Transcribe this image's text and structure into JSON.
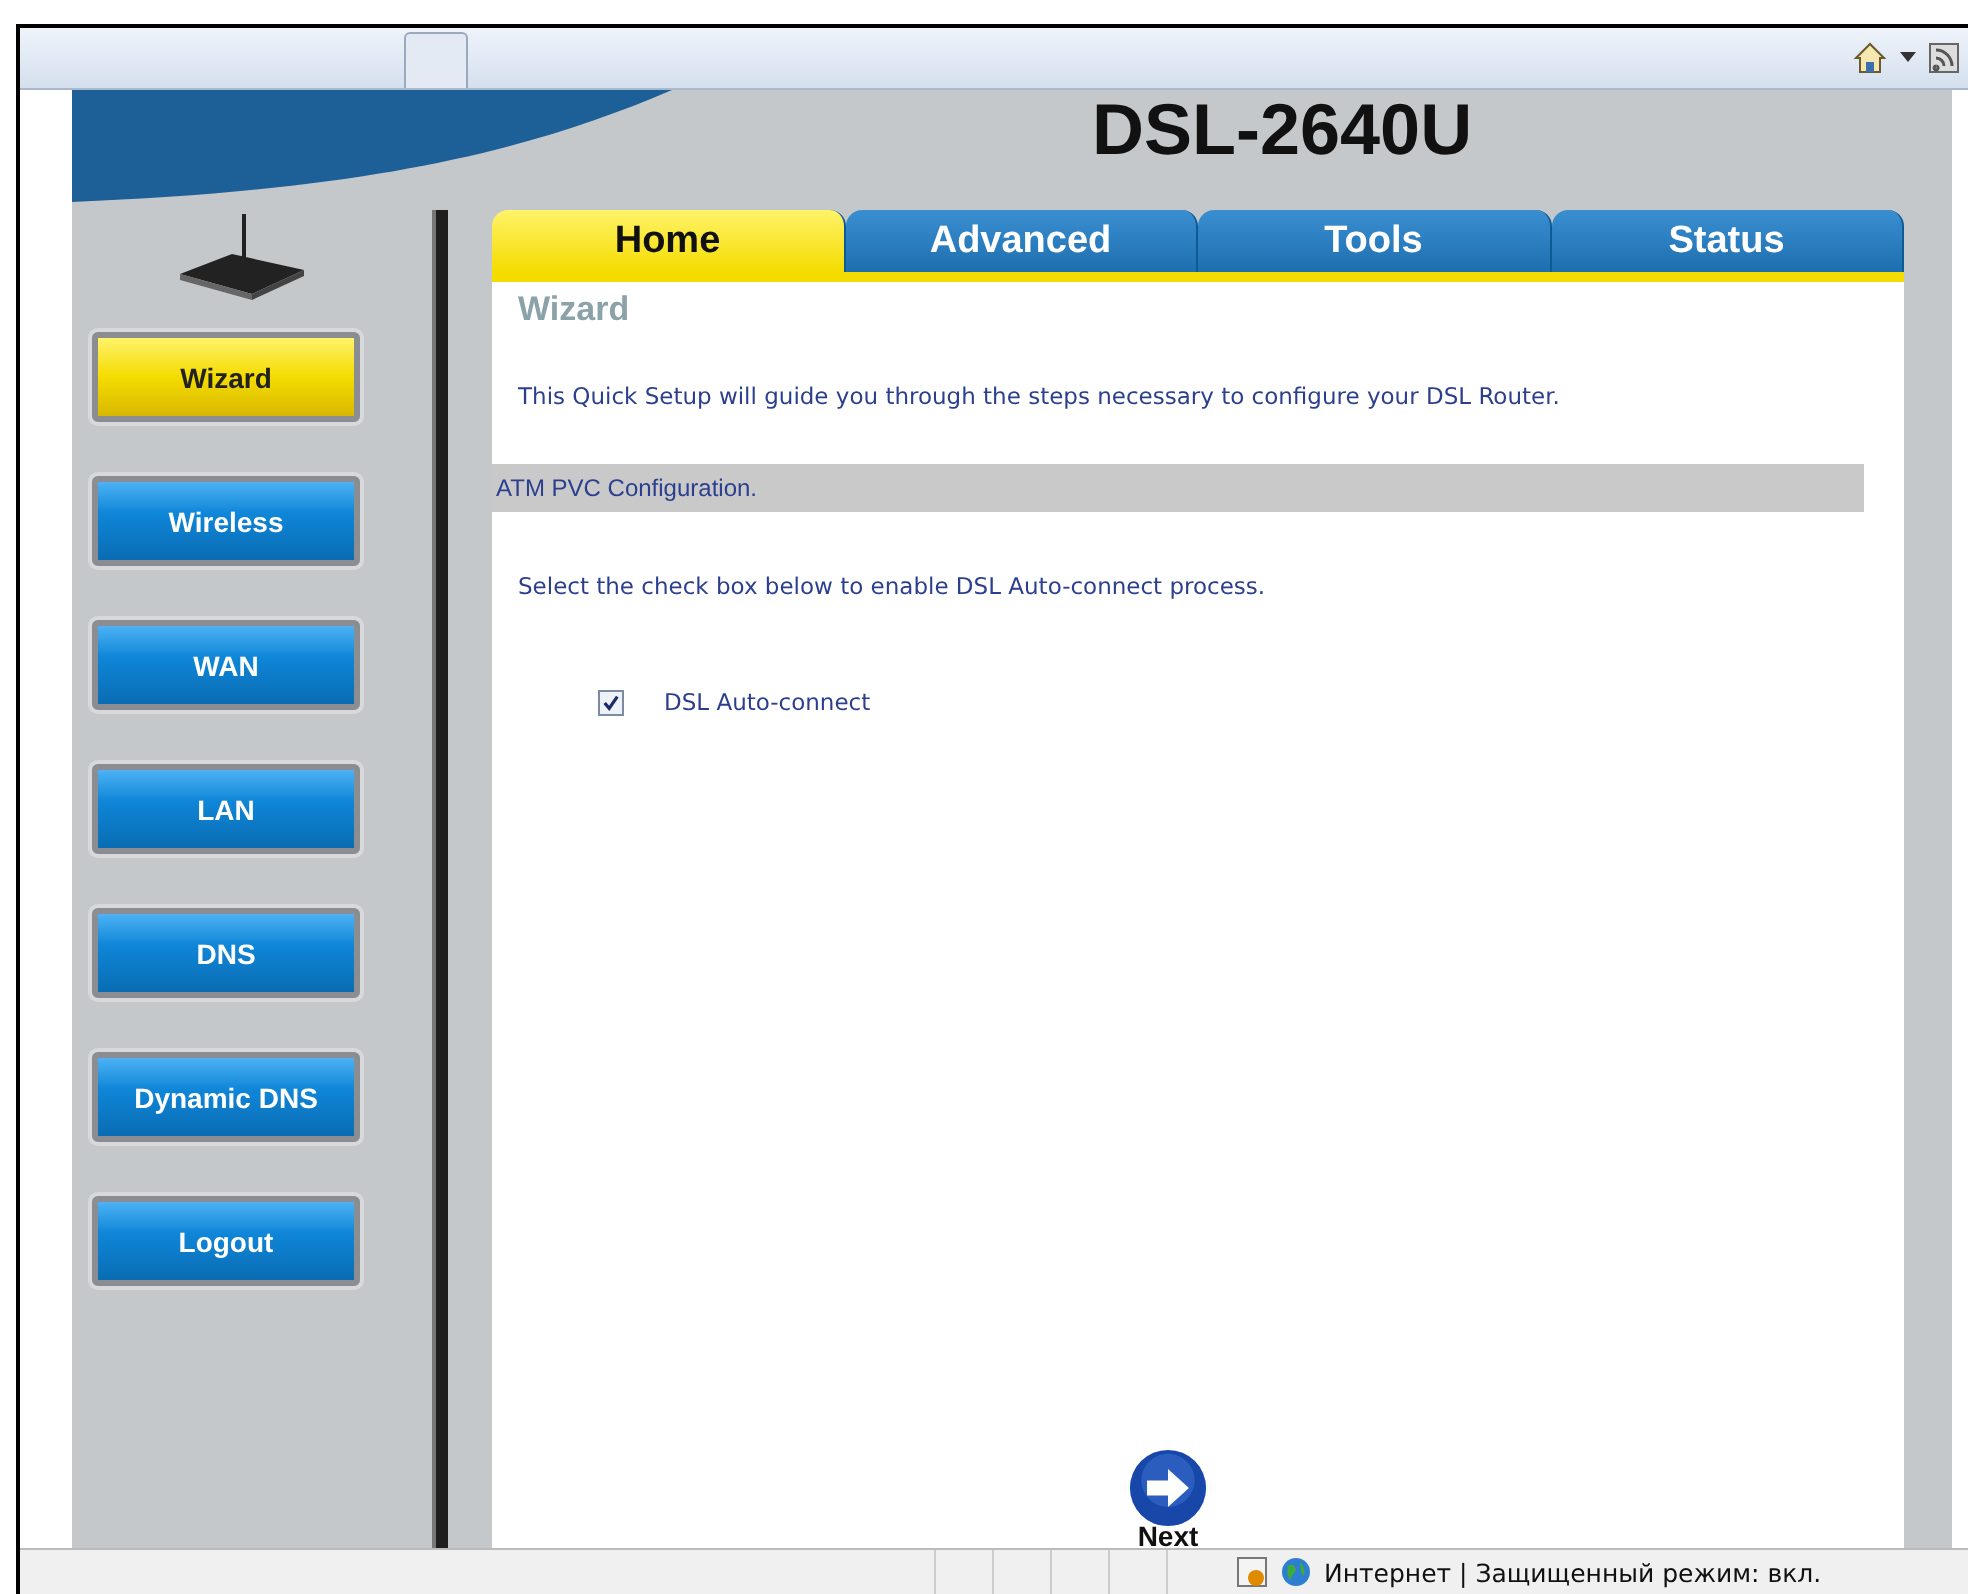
{
  "header": {
    "model": "DSL-2640U"
  },
  "tabs": [
    {
      "label": "Home",
      "selected": true
    },
    {
      "label": "Advanced",
      "selected": false
    },
    {
      "label": "Tools",
      "selected": false
    },
    {
      "label": "Status",
      "selected": false
    }
  ],
  "sidebar": {
    "items": [
      {
        "label": "Wizard",
        "selected": true
      },
      {
        "label": "Wireless",
        "selected": false
      },
      {
        "label": "WAN",
        "selected": false
      },
      {
        "label": "LAN",
        "selected": false
      },
      {
        "label": "DNS",
        "selected": false
      },
      {
        "label": "Dynamic DNS",
        "selected": false
      },
      {
        "label": "Logout",
        "selected": false
      }
    ]
  },
  "content": {
    "heading": "Wizard",
    "intro": "This Quick Setup will guide you through the steps necessary to configure your DSL Router.",
    "section": "ATM PVC Configuration.",
    "instruction": "Select the check box below to enable DSL Auto-connect process.",
    "checkbox": {
      "label": "DSL Auto-connect",
      "checked": true
    },
    "next_label": "Next"
  },
  "status_bar": {
    "zone": "Интернет | Защищенный режим: вкл."
  }
}
